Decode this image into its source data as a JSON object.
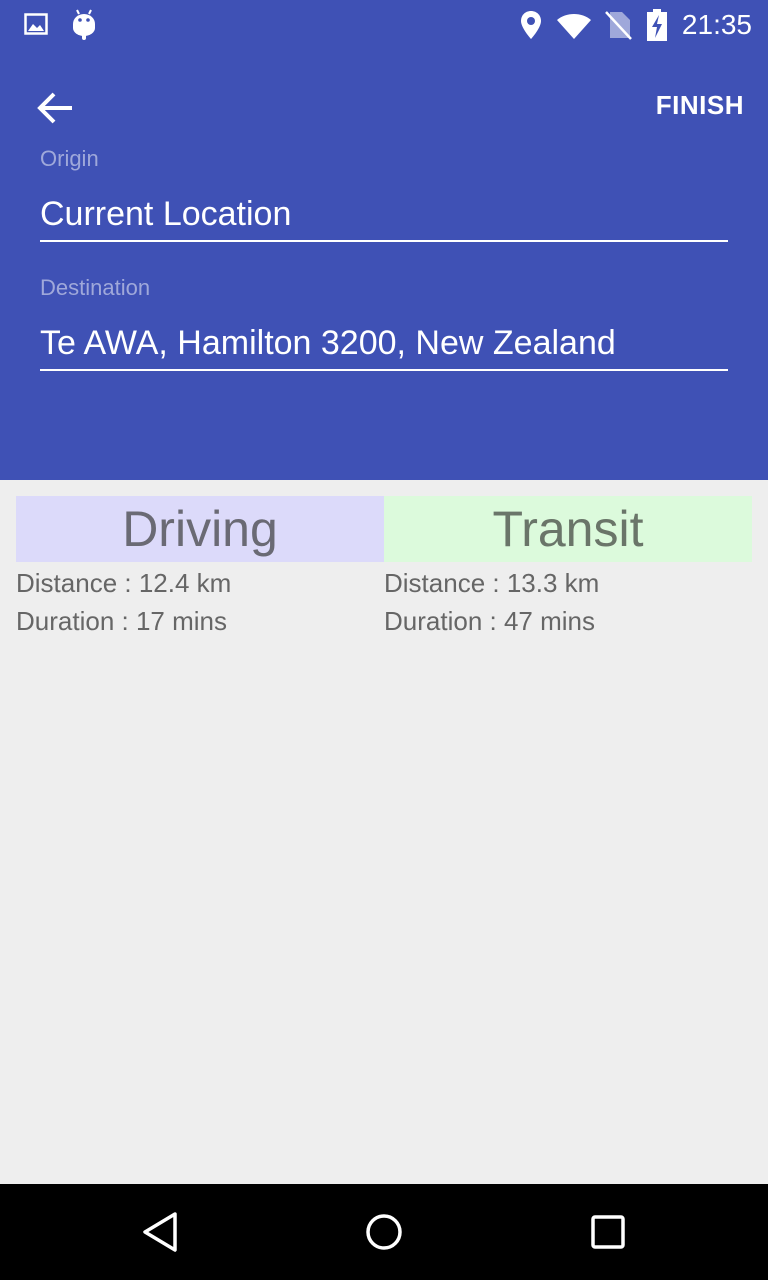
{
  "status_bar": {
    "time": "21:35",
    "icons": [
      "gallery-icon",
      "android-icon",
      "location-pin-icon",
      "wifi-icon",
      "no-sim-icon",
      "battery-charging-icon"
    ]
  },
  "header": {
    "back_icon": "arrow-left-icon",
    "action_label": "FINISH"
  },
  "form": {
    "origin": {
      "label": "Origin",
      "value": "Current Location"
    },
    "destination": {
      "label": "Destination",
      "value": "Te AWA, Hamilton 3200, New Zealand"
    }
  },
  "results": [
    {
      "mode": "Driving",
      "distance": "Distance : 12.4 km",
      "duration": "Duration : 17 mins",
      "header_bg": "#dcdafa",
      "header_fg": "#6a6a74"
    },
    {
      "mode": "Transit",
      "distance": "Distance : 13.3 km",
      "duration": "Duration : 47 mins",
      "header_bg": "#dcfadc",
      "header_fg": "#6a7569"
    }
  ],
  "nav_bar": {
    "buttons": [
      "back-triangle-icon",
      "home-circle-icon",
      "recents-square-icon"
    ]
  },
  "colors": {
    "primary": "#3f51b5",
    "background": "#eeeeee"
  }
}
